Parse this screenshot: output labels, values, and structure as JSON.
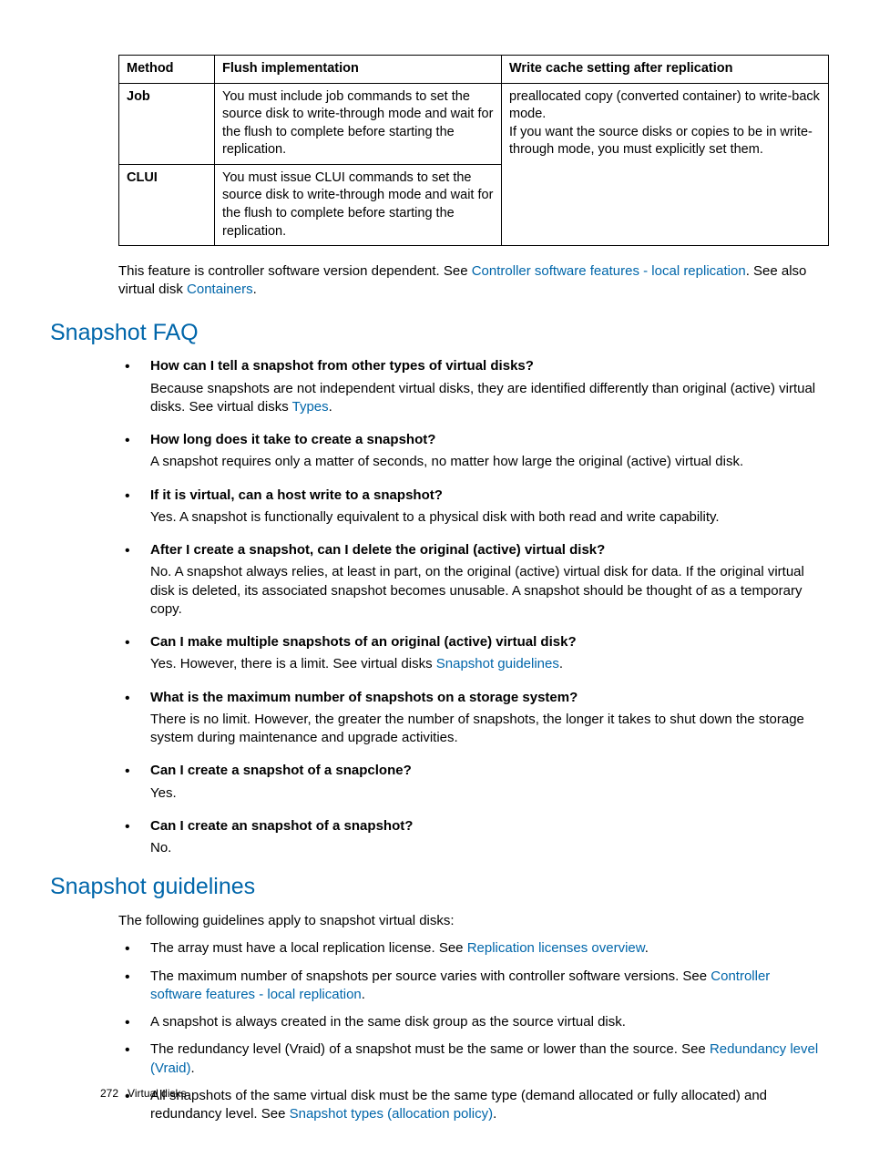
{
  "table": {
    "headers": [
      "Method",
      "Flush implementation",
      "Write cache setting after replication"
    ],
    "rows": [
      {
        "method": "Job",
        "flush": "You must include job commands to set the source disk to write-through mode and wait for the flush to complete before starting the replication."
      },
      {
        "method": "CLUI",
        "flush": "You must issue CLUI commands to set the source disk to write-through mode and wait for the flush to complete before starting the replication."
      }
    ],
    "write_cache": "preallocated copy (converted container) to write-back mode.\nIf you want the source disks or copies to be in write-through mode, you must explicitly set them."
  },
  "intro": {
    "t1": "This feature is controller software version dependent. See ",
    "link1": "Controller software features - local replication",
    "t2": ". See also virtual disk ",
    "link2": "Containers",
    "t3": "."
  },
  "faq_heading": "Snapshot FAQ",
  "faq": [
    {
      "q": "How can I tell a snapshot from other types of virtual disks?",
      "a_pre": "Because snapshots are not independent virtual disks, they are identified differently than original (active) virtual disks. See virtual disks ",
      "a_link": "Types",
      "a_post": "."
    },
    {
      "q": "How long does it take to create a snapshot?",
      "a_pre": "A snapshot requires only a matter of seconds, no matter how large the original (active) virtual disk.",
      "a_link": "",
      "a_post": ""
    },
    {
      "q": "If it is virtual, can a host write to a snapshot?",
      "a_pre": "Yes. A snapshot is functionally equivalent to a physical disk with both read and write capability.",
      "a_link": "",
      "a_post": ""
    },
    {
      "q": "After I create a snapshot, can I delete the original (active) virtual disk?",
      "a_pre": "No. A snapshot always relies, at least in part, on the original (active) virtual disk for data. If the original virtual disk is deleted, its associated snapshot becomes unusable. A snapshot should be thought of as a temporary copy.",
      "a_link": "",
      "a_post": ""
    },
    {
      "q": "Can I make multiple snapshots of an original (active) virtual disk?",
      "a_pre": "Yes. However, there is a limit. See virtual disks ",
      "a_link": "Snapshot guidelines",
      "a_post": "."
    },
    {
      "q": "What is the maximum number of snapshots on a storage system?",
      "a_pre": "There is no limit. However, the greater the number of snapshots, the longer it takes to shut down the storage system during maintenance and upgrade activities.",
      "a_link": "",
      "a_post": ""
    },
    {
      "q": "Can I create a snapshot of a snapclone?",
      "a_pre": "Yes.",
      "a_link": "",
      "a_post": ""
    },
    {
      "q": "Can I create an snapshot of a snapshot?",
      "a_pre": "No.",
      "a_link": "",
      "a_post": ""
    }
  ],
  "guidelines_heading": "Snapshot guidelines",
  "guidelines_intro": "The following guidelines apply to snapshot virtual disks:",
  "guidelines": [
    {
      "pre": "The array must have a local replication license. See ",
      "link": "Replication licenses overview",
      "post": "."
    },
    {
      "pre": "The maximum number of snapshots per source varies with controller software versions. See ",
      "link": "Controller software features - local replication",
      "post": "."
    },
    {
      "pre": "A snapshot is always created in the same disk group as the source virtual disk.",
      "link": "",
      "post": ""
    },
    {
      "pre": "The redundancy level (Vraid) of a snapshot must be the same or lower than the source. See ",
      "link": "Redundancy level (Vraid)",
      "post": "."
    },
    {
      "pre": "All snapshots of the same virtual disk must be the same type (demand allocated or fully allocated) and redundancy level. See ",
      "link": "Snapshot types (allocation policy)",
      "post": "."
    }
  ],
  "footer": {
    "page": "272",
    "section": "Virtual disks"
  }
}
